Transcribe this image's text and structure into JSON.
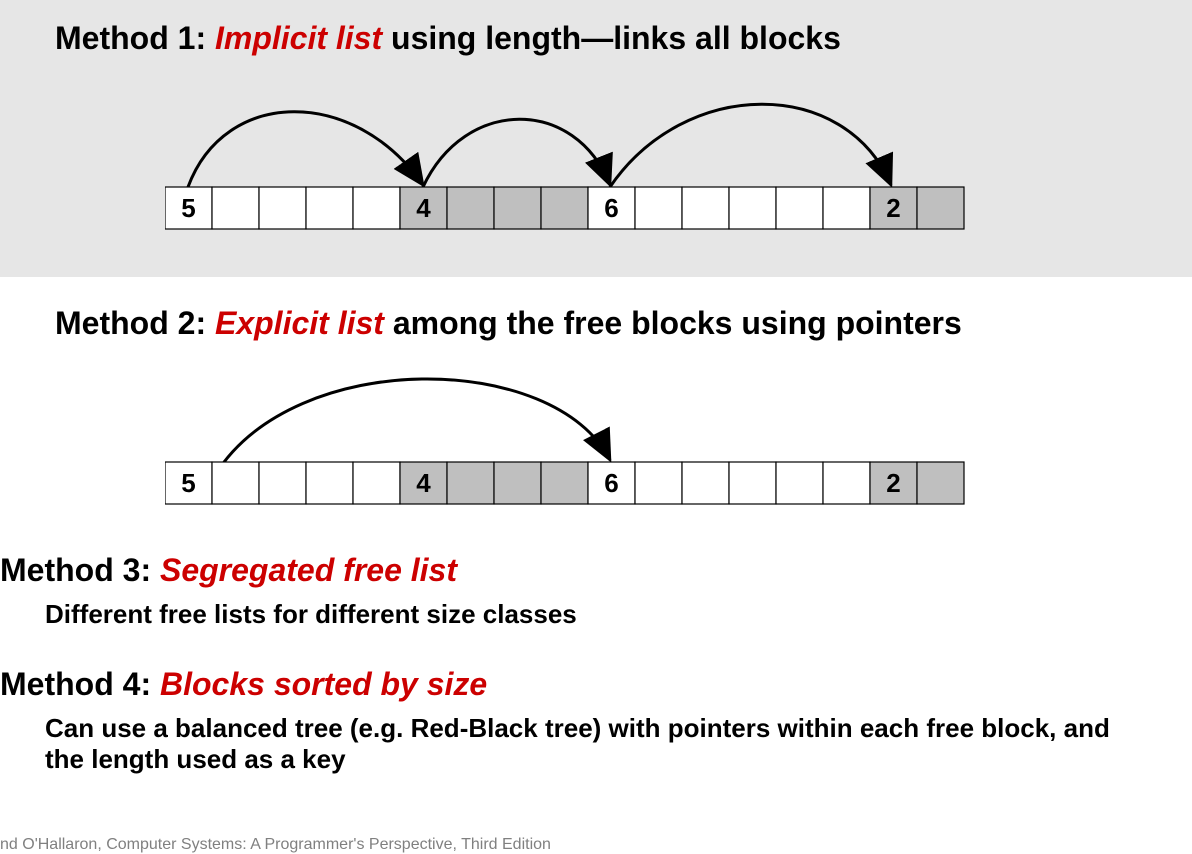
{
  "method1": {
    "label_prefix": "Method 1: ",
    "red": "Implicit list",
    "suffix": " using length—links all blocks",
    "blocks": [
      {
        "len": 5,
        "allocated": false
      },
      {
        "len": 4,
        "allocated": true
      },
      {
        "len": 6,
        "allocated": false
      },
      {
        "len": 2,
        "allocated": true
      }
    ]
  },
  "method2": {
    "label_prefix": "Method 2: ",
    "red": "Explicit list",
    "suffix": " among the free blocks using pointers",
    "blocks": [
      {
        "len": 5,
        "allocated": false
      },
      {
        "len": 4,
        "allocated": true
      },
      {
        "len": 6,
        "allocated": false
      },
      {
        "len": 2,
        "allocated": true
      }
    ]
  },
  "method3": {
    "label_prefix": "Method 3: ",
    "red": "Segregated free list",
    "subtext": "Different free lists for different size classes"
  },
  "method4": {
    "label_prefix": "Method 4: ",
    "red": "Blocks sorted by size",
    "subtext": "Can use a balanced tree (e.g. Red-Black tree) with pointers within each free block, and the length used as a key"
  },
  "citation": "nd O'Hallaron, Computer Systems: A Programmer's Perspective, Third Edition"
}
